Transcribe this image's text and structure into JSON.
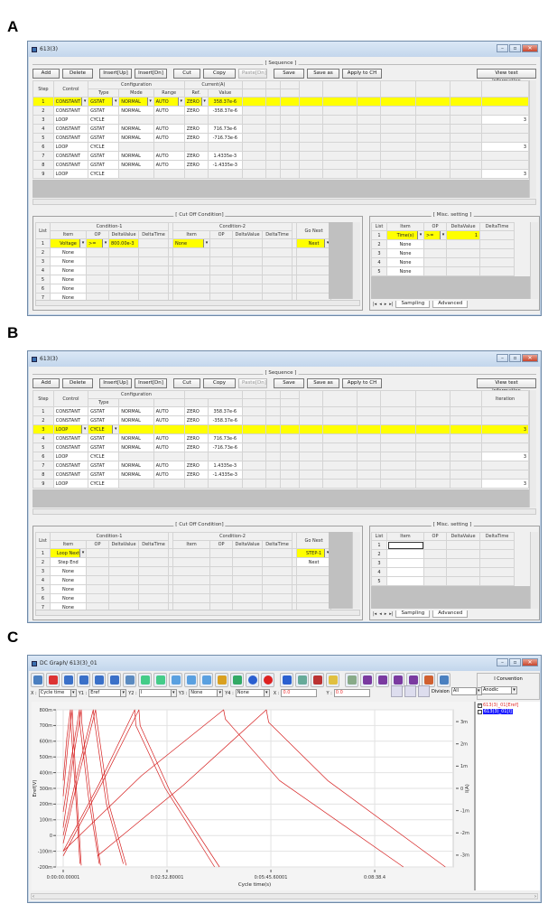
{
  "panel_labels": [
    "A",
    "B",
    "C"
  ],
  "toolbar_labels": [
    "Add",
    "Delete",
    "Insert[Up]",
    "Insert[Dn]",
    "Cut",
    "Copy",
    "Paste[Dn]",
    "Save",
    "Save as",
    "Apply to CH"
  ],
  "view_test_info": "View test information",
  "window_controls": [
    "minimize-icon",
    "maximize-icon",
    "close-icon"
  ],
  "highlight_color": "#ffff00",
  "panel_a": {
    "title": "613(3)",
    "sequence_title": "[ Sequence ]",
    "headers": {
      "step": "Step",
      "control": "Control",
      "configuration": "Configuration",
      "type": "Type",
      "mode": "Mode",
      "range": "Range",
      "current": "Current(A)",
      "ref": "Ref.",
      "value": "Value",
      "iteration": ""
    },
    "rows": [
      [
        "1",
        "CONSTANT",
        "GSTAT",
        "NORMAL",
        "AUTO",
        "ZERO",
        "358.37e-6",
        ""
      ],
      [
        "2",
        "CONSTANT",
        "GSTAT",
        "NORMAL",
        "AUTO",
        "ZERO",
        "-358.37e-6",
        ""
      ],
      [
        "3",
        "LOOP",
        "CYCLE",
        "",
        "",
        "",
        "",
        "3"
      ],
      [
        "4",
        "CONSTANT",
        "GSTAT",
        "NORMAL",
        "AUTO",
        "ZERO",
        "716.73e-6",
        ""
      ],
      [
        "5",
        "CONSTANT",
        "GSTAT",
        "NORMAL",
        "AUTO",
        "ZERO",
        "-716.73e-6",
        ""
      ],
      [
        "6",
        "LOOP",
        "CYCLE",
        "",
        "",
        "",
        "",
        "3"
      ],
      [
        "7",
        "CONSTANT",
        "GSTAT",
        "NORMAL",
        "AUTO",
        "ZERO",
        "1.4335e-3",
        ""
      ],
      [
        "8",
        "CONSTANT",
        "GSTAT",
        "NORMAL",
        "AUTO",
        "ZERO",
        "-1.4335e-3",
        ""
      ],
      [
        "9",
        "LOOP",
        "CYCLE",
        "",
        "",
        "",
        "",
        "3"
      ]
    ],
    "selected_row": 0,
    "cutoff": {
      "title": "[ Cut Off Condition]",
      "headers": {
        "list": "List",
        "cond1": "Condition-1",
        "cond2": "Condition-2",
        "item": "Item",
        "op": "OP",
        "delta_value": "DeltaValue",
        "delta_time": "DeltaTime",
        "go_next": "Go Next"
      },
      "rows": [
        [
          "1",
          "Voltage",
          ">=",
          "800.00e-3",
          "",
          "None",
          "",
          "",
          "",
          "Next"
        ],
        [
          "2",
          "None",
          "",
          "",
          "",
          "",
          "",
          "",
          "",
          ""
        ],
        [
          "3",
          "None",
          "",
          "",
          "",
          "",
          "",
          "",
          "",
          ""
        ],
        [
          "4",
          "None",
          "",
          "",
          "",
          "",
          "",
          "",
          "",
          ""
        ],
        [
          "5",
          "None",
          "",
          "",
          "",
          "",
          "",
          "",
          "",
          ""
        ],
        [
          "6",
          "None",
          "",
          "",
          "",
          "",
          "",
          "",
          "",
          ""
        ],
        [
          "7",
          "None",
          "",
          "",
          "",
          "",
          "",
          "",
          "",
          ""
        ]
      ]
    },
    "misc": {
      "title": "[ Misc. setting ]",
      "headers": {
        "list": "List",
        "item": "Item",
        "op": "OP",
        "delta_value": "DeltaValue",
        "delta_time": "DeltaTime"
      },
      "rows": [
        [
          "1",
          "Time(s)",
          ">=",
          "1",
          ""
        ],
        [
          "2",
          "None",
          "",
          "",
          ""
        ],
        [
          "3",
          "None",
          "",
          "",
          ""
        ],
        [
          "4",
          "None",
          "",
          "",
          ""
        ],
        [
          "5",
          "None",
          "",
          "",
          ""
        ]
      ],
      "tabs": [
        "Sampling",
        "Advanced"
      ]
    }
  },
  "panel_b": {
    "title": "613(3)",
    "sequence_title": "[ Sequence ]",
    "headers": {
      "step": "Step",
      "control": "Control",
      "configuration": "Configuration",
      "type": "Type",
      "mode": "",
      "range": "",
      "current": "",
      "ref": "",
      "value": "",
      "iteration": "Iteration"
    },
    "rows": [
      [
        "1",
        "CONSTANT",
        "GSTAT",
        "NORMAL",
        "AUTO",
        "ZERO",
        "358.37e-6",
        ""
      ],
      [
        "2",
        "CONSTANT",
        "GSTAT",
        "NORMAL",
        "AUTO",
        "ZERO",
        "-358.37e-6",
        ""
      ],
      [
        "3",
        "LOOP",
        "CYCLE",
        "",
        "",
        "",
        "",
        "3"
      ],
      [
        "4",
        "CONSTANT",
        "GSTAT",
        "NORMAL",
        "AUTO",
        "ZERO",
        "716.73e-6",
        ""
      ],
      [
        "5",
        "CONSTANT",
        "GSTAT",
        "NORMAL",
        "AUTO",
        "ZERO",
        "-716.73e-6",
        ""
      ],
      [
        "6",
        "LOOP",
        "CYCLE",
        "",
        "",
        "",
        "",
        "3"
      ],
      [
        "7",
        "CONSTANT",
        "GSTAT",
        "NORMAL",
        "AUTO",
        "ZERO",
        "1.4335e-3",
        ""
      ],
      [
        "8",
        "CONSTANT",
        "GSTAT",
        "NORMAL",
        "AUTO",
        "ZERO",
        "-1.4335e-3",
        ""
      ],
      [
        "9",
        "LOOP",
        "CYCLE",
        "",
        "",
        "",
        "",
        "3"
      ]
    ],
    "selected_row": 2,
    "cutoff": {
      "title": "[ Cut Off Condition]",
      "headers": {
        "list": "List",
        "cond1": "Condition-1",
        "cond2": "Condition-2",
        "item": "Item",
        "op": "OP",
        "delta_value": "DeltaValue",
        "delta_time": "DeltaTime",
        "go_next": "Go Next"
      },
      "rows": [
        [
          "1",
          "Loop Next",
          "",
          "",
          "",
          "",
          "",
          "",
          "",
          "STEP-1"
        ],
        [
          "2",
          "Step End",
          "",
          "",
          "",
          "",
          "",
          "",
          "",
          "Next"
        ],
        [
          "3",
          "None",
          "",
          "",
          "",
          "",
          "",
          "",
          "",
          ""
        ],
        [
          "4",
          "None",
          "",
          "",
          "",
          "",
          "",
          "",
          "",
          ""
        ],
        [
          "5",
          "None",
          "",
          "",
          "",
          "",
          "",
          "",
          "",
          ""
        ],
        [
          "6",
          "None",
          "",
          "",
          "",
          "",
          "",
          "",
          "",
          ""
        ],
        [
          "7",
          "None",
          "",
          "",
          "",
          "",
          "",
          "",
          "",
          ""
        ]
      ]
    },
    "misc": {
      "title": "[ Misc. setting ]",
      "headers": {
        "list": "List",
        "item": "Item",
        "op": "OP",
        "delta_value": "DeltaValue",
        "delta_time": "DeltaTime"
      },
      "rows": [
        [
          "1",
          "",
          "",
          "",
          ""
        ],
        [
          "2",
          "",
          "",
          "",
          ""
        ],
        [
          "3",
          "",
          "",
          "",
          ""
        ],
        [
          "4",
          "",
          "",
          "",
          ""
        ],
        [
          "5",
          "",
          "",
          "",
          ""
        ]
      ],
      "tabs": [
        "Sampling",
        "Advanced"
      ]
    }
  },
  "panel_c": {
    "title": "DC Graph/ 613(3)_01",
    "toolbar_icons": [
      "open-graph",
      "delete-graph",
      "align-y1",
      "align-y2",
      "align-y3",
      "align-y4",
      "view-3d",
      "swap-1",
      "swap-2",
      "zoom",
      "zoom-in",
      "zoom-fit",
      "layout",
      "legend-list",
      "line-style",
      "record",
      "grid-table",
      "map",
      "print-preview",
      "notes",
      "spreadsheet",
      "iv-1",
      "iv-2",
      "iv-3",
      "iv-4",
      "export",
      "printer"
    ],
    "toolbar_colors": [
      "#4a7fc0",
      "#d33",
      "#3a70c8",
      "#3a70c8",
      "#3a70c8",
      "#3a70c8",
      "#5a8ac0",
      "#4c8",
      "#4c8",
      "#5aa0e0",
      "#5aa0e0",
      "#5aa0e0",
      "#d9a020",
      "#3a6",
      "#2a5fd0",
      "#d22",
      "#2a60d0",
      "#6a9",
      "#b33",
      "#e0c040",
      "#8a8",
      "#7a3aa0",
      "#7a3aa0",
      "#7a3aa0",
      "#7a3aa0",
      "#d06030",
      "#4a80c0"
    ],
    "x_label": "X :",
    "x_value": "Cycle time",
    "y1_label": "Y1 :",
    "y1_value": "Eref",
    "y2_label": "Y2 :",
    "y2_value": "I",
    "y3_label": "Y3 :",
    "y3_value": "None",
    "y4_label": "Y4 :",
    "y4_value": "None",
    "cursor_x_label": "X :",
    "cursor_x": "0.0",
    "cursor_y_label": "Y :",
    "cursor_y": "0.0",
    "division_label": "Division",
    "division_value": "All",
    "convention_label": "I Convention",
    "convention_value": "Anodic",
    "legend": [
      {
        "label": "613(3)_01[Eref]",
        "checked": true,
        "color": "#e03030"
      },
      {
        "label": "613(3)_01[I]",
        "checked": false,
        "color": "#ffffff"
      }
    ]
  },
  "chart_data": {
    "type": "line",
    "xlabel": "Cycle time(s)",
    "ylabel": "Eref(V)",
    "y2label": "I(A)",
    "xlim": [
      -12,
      649
    ],
    "ylim": [
      -0.2,
      0.8
    ],
    "y2lim": [
      -0.00353,
      0.00353
    ],
    "x_ticks": [
      {
        "value": 0,
        "label": "0:00:00.00001"
      },
      {
        "value": 172.8,
        "label": "0:02:52.80001"
      },
      {
        "value": 345.6,
        "label": "0:05:45.60001"
      },
      {
        "value": 518.4,
        "label": "0:08:38.4"
      }
    ],
    "y_ticks": [
      {
        "value": 0.8,
        "label": "800m"
      },
      {
        "value": 0.7,
        "label": "700m"
      },
      {
        "value": 0.6,
        "label": "600m"
      },
      {
        "value": 0.5,
        "label": "500m"
      },
      {
        "value": 0.4,
        "label": "400m"
      },
      {
        "value": 0.3,
        "label": "300m"
      },
      {
        "value": 0.2,
        "label": "200m"
      },
      {
        "value": 0.1,
        "label": "100m"
      },
      {
        "value": 0,
        "label": "0"
      },
      {
        "value": -0.1,
        "label": "-100m"
      },
      {
        "value": -0.2,
        "label": "-200m"
      }
    ],
    "y2_ticks": [
      {
        "value": 0.003,
        "label": "3m"
      },
      {
        "value": 0.002,
        "label": "2m"
      },
      {
        "value": 0.001,
        "label": "1m"
      },
      {
        "value": 0,
        "label": "0"
      },
      {
        "value": -0.001,
        "label": "-1m"
      },
      {
        "value": -0.002,
        "label": "-2m"
      },
      {
        "value": -0.003,
        "label": "-3m"
      }
    ],
    "grid": true,
    "series_color": "#d62020",
    "series": [
      {
        "points": [
          [
            0,
            0.35
          ],
          [
            6,
            0.62
          ],
          [
            12,
            0.8
          ],
          [
            13,
            0.7
          ],
          [
            20,
            0.3
          ],
          [
            28,
            -0.18
          ]
        ]
      },
      {
        "points": [
          [
            0,
            0.25
          ],
          [
            8,
            0.58
          ],
          [
            15,
            0.8
          ],
          [
            16,
            0.72
          ],
          [
            22,
            0.3
          ],
          [
            30,
            -0.19
          ]
        ]
      },
      {
        "points": [
          [
            0,
            0.15
          ],
          [
            14,
            0.5
          ],
          [
            27,
            0.8
          ],
          [
            28,
            0.7
          ],
          [
            42,
            0.25
          ],
          [
            60,
            -0.18
          ]
        ]
      },
      {
        "points": [
          [
            0,
            0.05
          ],
          [
            15,
            0.45
          ],
          [
            30,
            0.8
          ],
          [
            31,
            0.72
          ],
          [
            45,
            0.27
          ],
          [
            62,
            -0.19
          ]
        ]
      },
      {
        "points": [
          [
            0,
            0.0
          ],
          [
            25,
            0.42
          ],
          [
            50,
            0.8
          ],
          [
            52,
            0.73
          ],
          [
            72,
            0.2
          ],
          [
            100,
            -0.18
          ]
        ]
      },
      {
        "points": [
          [
            0,
            -0.05
          ],
          [
            27,
            0.4
          ],
          [
            54,
            0.8
          ],
          [
            56,
            0.73
          ],
          [
            76,
            0.2
          ],
          [
            105,
            -0.19
          ]
        ]
      },
      {
        "points": [
          [
            0,
            -0.1
          ],
          [
            60,
            0.33
          ],
          [
            119,
            0.8
          ],
          [
            121,
            0.7
          ],
          [
            170,
            0.3
          ],
          [
            252,
            -0.2
          ]
        ]
      },
      {
        "points": [
          [
            0,
            -0.13
          ],
          [
            64,
            0.33
          ],
          [
            126,
            0.8
          ],
          [
            128,
            0.7
          ],
          [
            178,
            0.28
          ],
          [
            260,
            -0.2
          ]
        ]
      },
      {
        "points": [
          [
            0,
            -0.1
          ],
          [
            130,
            0.38
          ],
          [
            267,
            0.8
          ],
          [
            270,
            0.74
          ],
          [
            360,
            0.35
          ],
          [
            566,
            -0.2
          ]
        ]
      },
      {
        "points": [
          [
            57,
            -0.13
          ],
          [
            200,
            0.32
          ],
          [
            338,
            0.8
          ],
          [
            342,
            0.72
          ],
          [
            440,
            0.35
          ],
          [
            636,
            -0.2
          ]
        ]
      }
    ]
  }
}
